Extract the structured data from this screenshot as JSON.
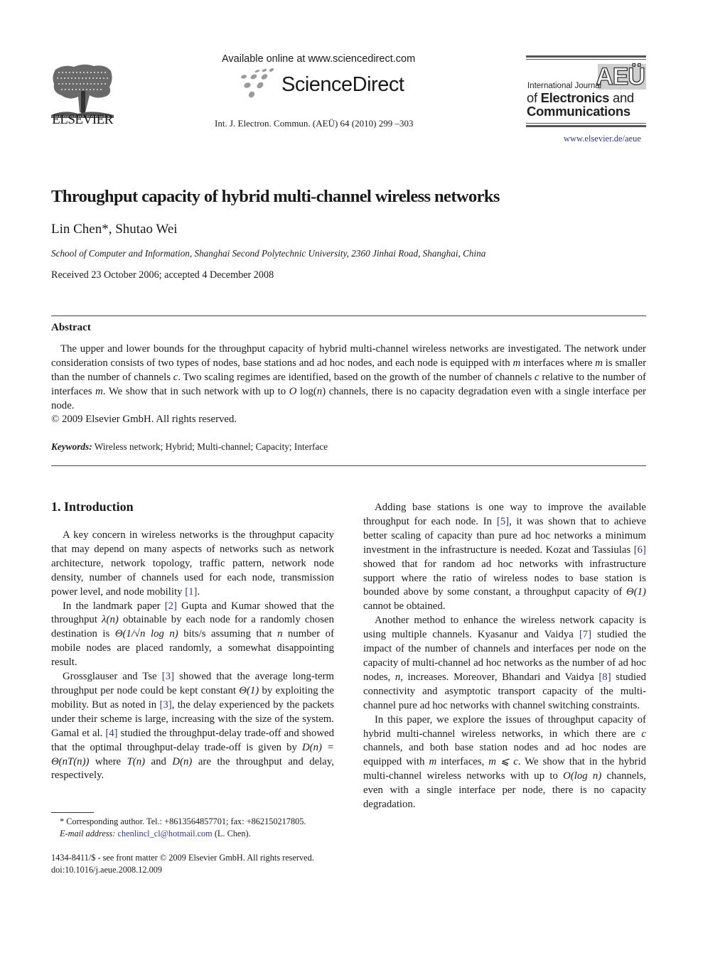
{
  "header": {
    "publisher_name": "ELSEVIER",
    "sciencedirect_available": "Available online at www.sciencedirect.com",
    "sciencedirect_name": "ScienceDirect",
    "citation": "Int. J. Electron. Commun. (AEÜ) 64 (2010) 299 –303",
    "journal": {
      "badge": "AEÜ",
      "line1": "International Journal",
      "line2_prefix": "of ",
      "line2_bold": "Electronics",
      "line2_suffix": " and",
      "line3": "Communications",
      "url": "www.elsevier.de/aeue"
    }
  },
  "article": {
    "title": "Throughput capacity of hybrid multi-channel wireless networks",
    "authors": "Lin Chen*, Shutao Wei",
    "affiliation": "School of Computer and Information, Shanghai Second Polytechnic University, 2360 Jinhai Road, Shanghai, China",
    "received": "Received 23 October 2006; accepted 4 December 2008"
  },
  "abstract": {
    "heading": "Abstract",
    "p1_a": "The upper and lower bounds for the throughput capacity of hybrid multi-channel wireless networks are investigated. The network under consideration consists of two types of nodes, base stations and ad hoc nodes, and each node is equipped with ",
    "p1_m1": "m",
    "p1_b": " interfaces where ",
    "p1_m2": "m",
    "p1_c": " is smaller than the number of channels ",
    "p1_c1": "c",
    "p1_d": ". Two scaling regimes are identified, based on the growth of the number of channels ",
    "p1_c2": "c",
    "p1_e": " relative to the number of interfaces ",
    "p1_m3": "m",
    "p1_f": ". We show that in such network with up to ",
    "p1_O": "O",
    "p1_g": " log(",
    "p1_n": "n",
    "p1_h": ") channels, there is no capacity degradation even with a single interface per node.",
    "copyright": "© 2009 Elsevier GmbH. All rights reserved."
  },
  "keywords": {
    "label": "Keywords:",
    "items": "Wireless network; Hybrid; Multi-channel; Capacity; Interface"
  },
  "introduction": {
    "heading": "1. Introduction",
    "p1": "A key concern in wireless networks is the throughput capacity that may depend on many aspects of networks such as network architecture, network topology, traffic pattern, network node density, number of channels used for each node, transmission power level, and node mobility ",
    "p1_ref": "[1]",
    "p2_a": "In the landmark paper ",
    "p2_ref": "[2]",
    "p2_b": " Gupta and Kumar showed that the throughput ",
    "p2_lambda": "λ(n)",
    "p2_c": " obtainable by each node for a randomly chosen destination is ",
    "p2_theta": "Θ(1/√n log n)",
    "p2_d": " bits/s assuming that ",
    "p2_n": "n",
    "p2_e": " number of mobile nodes are placed randomly, a somewhat disappointing result.",
    "p3_a": "Grossglauser and Tse ",
    "p3_ref1": "[3]",
    "p3_b": " showed that the average long-term throughput per node could be kept constant ",
    "p3_theta": "Θ(1)",
    "p3_c": " by exploiting the mobility. But as noted in ",
    "p3_ref2": "[3]",
    "p3_d": ", the delay experienced by the packets under their scheme is large, increasing with the size of the system. Gamal et al. ",
    "p3_ref3": "[4]",
    "p3_e": " studied the throughput-delay trade-off and showed that the optimal throughput-delay trade-off is given by ",
    "p3_eq": "D(n) = Θ(nT(n))",
    "p3_f": " where ",
    "p3_T": "T(n)",
    "p3_g": " and ",
    "p3_D": "D(n)",
    "p3_h": " are the throughput and delay, respectively.",
    "p4_a": "Adding base stations is one way to improve the available throughput for each node. In ",
    "p4_ref1": "[5]",
    "p4_b": ", it was shown that to achieve better scaling of capacity than pure ad hoc networks a minimum investment in the infrastructure is needed. Kozat and Tassiulas ",
    "p4_ref2": "[6]",
    "p4_c": " showed that for random ad hoc networks with infrastructure support where the ratio of wireless nodes to base station is bounded above by some constant, a throughput capacity of ",
    "p4_theta": "Θ(1)",
    "p4_d": " cannot be obtained.",
    "p5_a": "Another method to enhance the wireless network capacity is using multiple channels. Kyasanur and Vaidya ",
    "p5_ref1": "[7]",
    "p5_b": " studied the impact of the number of channels and interfaces per node on the capacity of multi-channel ad hoc networks as the number of ad hoc nodes, ",
    "p5_n": "n",
    "p5_c": ", increases. Moreover, Bhandari and Vaidya ",
    "p5_ref2": "[8]",
    "p5_d": " studied connectivity and asymptotic transport capacity of the multi-channel pure ad hoc networks with channel switching constraints.",
    "p6_a": "In this paper, we explore the issues of throughput capacity of hybrid multi-channel wireless networks, in which there are ",
    "p6_c": "c",
    "p6_b": " channels, and both base station nodes and ad hoc nodes are equipped with ",
    "p6_m": "m",
    "p6_d": " interfaces, ",
    "p6_ineq": "m ⩽ c",
    "p6_e": ". We show that in the hybrid multi-channel wireless networks with up to ",
    "p6_O": "O(log n)",
    "p6_f": " channels, even with a single interface per node, there is no capacity degradation."
  },
  "footnote": {
    "line1": "* Corresponding author. Tel.: +8613564857701; fax: +862150217805.",
    "email_label": "E-mail address: ",
    "email": "chenlincl_cl@hotmail.com",
    "email_suffix": " (L. Chen)."
  },
  "front_matter": {
    "issn": "1434-8411/$ - see front matter © 2009 Elsevier GmbH. All rights reserved.",
    "doi": "doi:10.1016/j.aeue.2008.12.009"
  },
  "colors": {
    "link": "#2b3a8f",
    "text": "#1a1a1a"
  }
}
